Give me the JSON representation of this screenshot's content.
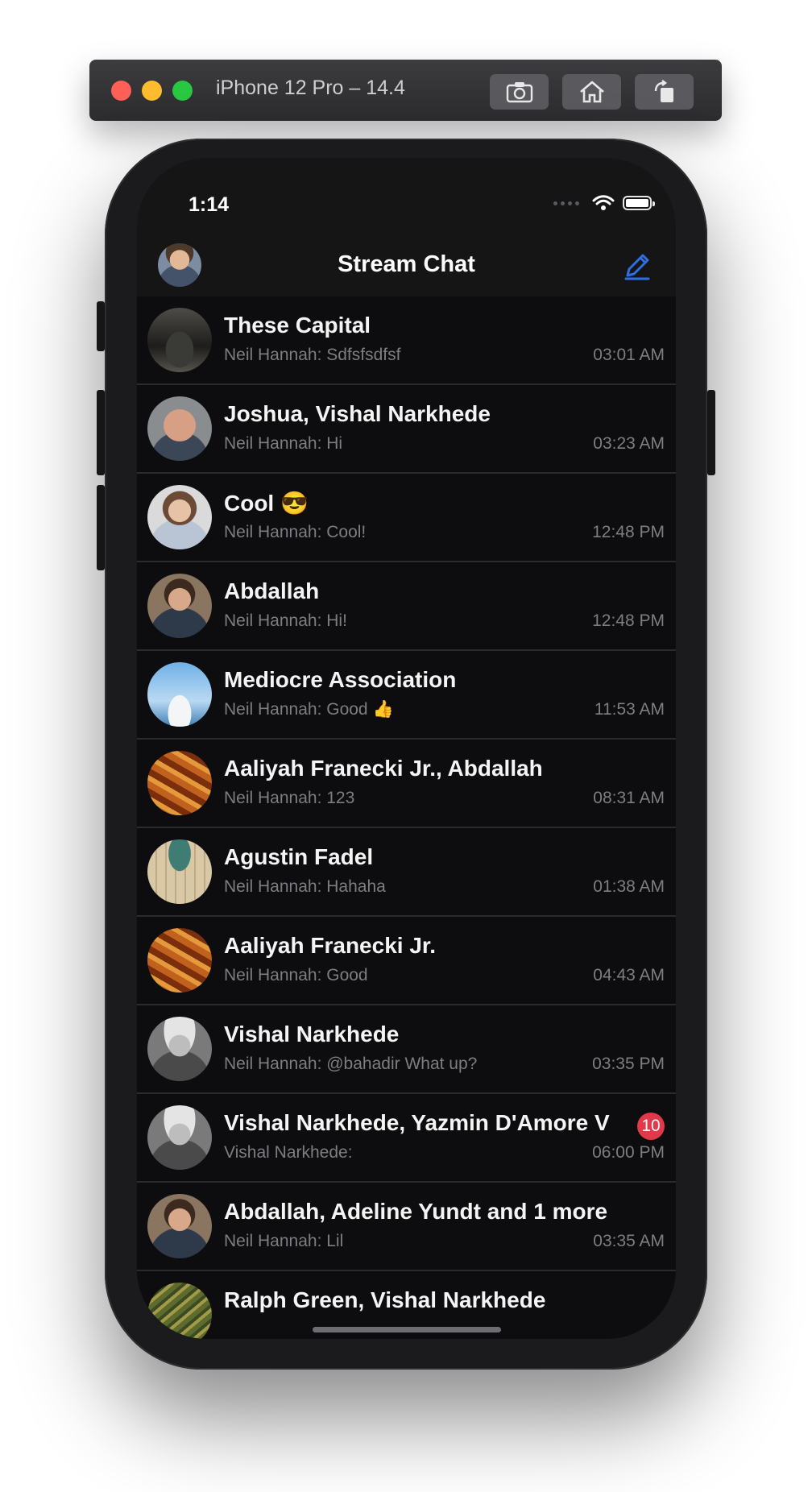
{
  "simulator": {
    "title": "iPhone 12 Pro – 14.4",
    "buttons": [
      "screenshot-icon",
      "home-icon",
      "rotate-icon"
    ]
  },
  "status_bar": {
    "time": "1:14"
  },
  "nav": {
    "title": "Stream Chat",
    "compose_icon": "compose-icon",
    "accent": "#2f6fe4"
  },
  "channels": [
    {
      "name": "These Capital",
      "preview": "Neil Hannah: Sdfsfsdfsf",
      "time": "03:01 AM"
    },
    {
      "name": "Joshua, Vishal Narkhede",
      "preview": "Neil Hannah: Hi",
      "time": "03:23 AM"
    },
    {
      "name": "Cool 😎",
      "preview": "Neil Hannah: Cool!",
      "time": "12:48 PM"
    },
    {
      "name": "Abdallah",
      "preview": "Neil Hannah: Hi!",
      "time": "12:48 PM"
    },
    {
      "name": "Mediocre Association",
      "preview": "Neil Hannah: Good 👍",
      "time": "11:53 AM"
    },
    {
      "name": "Aaliyah Franecki Jr., Abdallah",
      "preview": "Neil Hannah: 123",
      "time": "08:31 AM"
    },
    {
      "name": "Agustin Fadel",
      "preview": "Neil Hannah: Hahaha",
      "time": "01:38 AM"
    },
    {
      "name": "Aaliyah Franecki Jr.",
      "preview": "Neil Hannah: Good",
      "time": "04:43 AM"
    },
    {
      "name": "Vishal Narkhede",
      "preview": "Neil Hannah: @bahadir What up?",
      "time": "03:35 PM"
    },
    {
      "name": "Vishal Narkhede, Yazmin D'Amore V",
      "preview": "Vishal Narkhede:",
      "time": "06:00 PM",
      "unread": "10"
    },
    {
      "name": "Abdallah, Adeline Yundt and 1 more",
      "preview": "Neil Hannah: Lil",
      "time": "03:35 AM"
    },
    {
      "name": "Ralph Green, Vishal Narkhede",
      "preview": "",
      "time": ""
    }
  ]
}
